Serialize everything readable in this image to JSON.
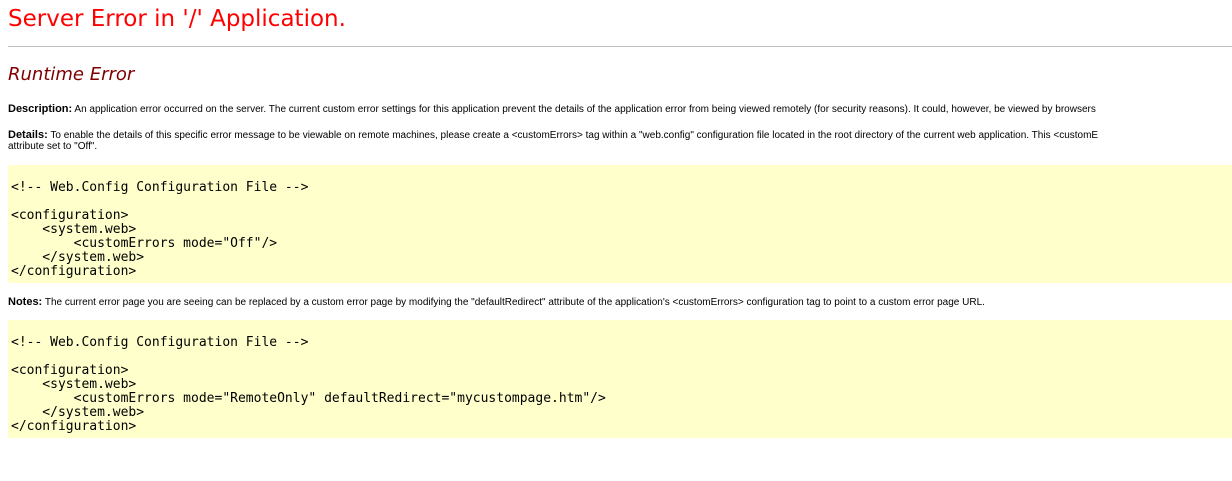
{
  "header": {
    "title": "Server Error in '/' Application."
  },
  "error": {
    "subtitle": "Runtime Error"
  },
  "description": {
    "label": "Description:",
    "text": " An application error occurred on the server. The current custom error settings for this application prevent the details of the application error from being viewed remotely (for security reasons). It could, however, be viewed by browsers"
  },
  "details": {
    "label": "Details:",
    "line1": " To enable the details of this specific error message to be viewable on remote machines, please create a <customErrors> tag within a \"web.config\" configuration file located in the root directory of the current web application. This <customE",
    "line2": "attribute set to \"Off\"."
  },
  "code_block_1": {
    "text": "<!-- Web.Config Configuration File -->\n\n<configuration>\n    <system.web>\n        <customErrors mode=\"Off\"/>\n    </system.web>\n</configuration>"
  },
  "notes": {
    "label": "Notes:",
    "text": " The current error page you are seeing can be replaced by a custom error page by modifying the \"defaultRedirect\" attribute of the application's <customErrors> configuration tag to point to a custom error page URL."
  },
  "code_block_2": {
    "text": "<!-- Web.Config Configuration File -->\n\n<configuration>\n    <system.web>\n        <customErrors mode=\"RemoteOnly\" defaultRedirect=\"mycustompage.htm\"/>\n    </system.web>\n</configuration>"
  },
  "colors": {
    "title": "#ff0000",
    "subtitle": "#800000",
    "code_background": "#ffffcc",
    "rule": "#c0c0c0"
  }
}
